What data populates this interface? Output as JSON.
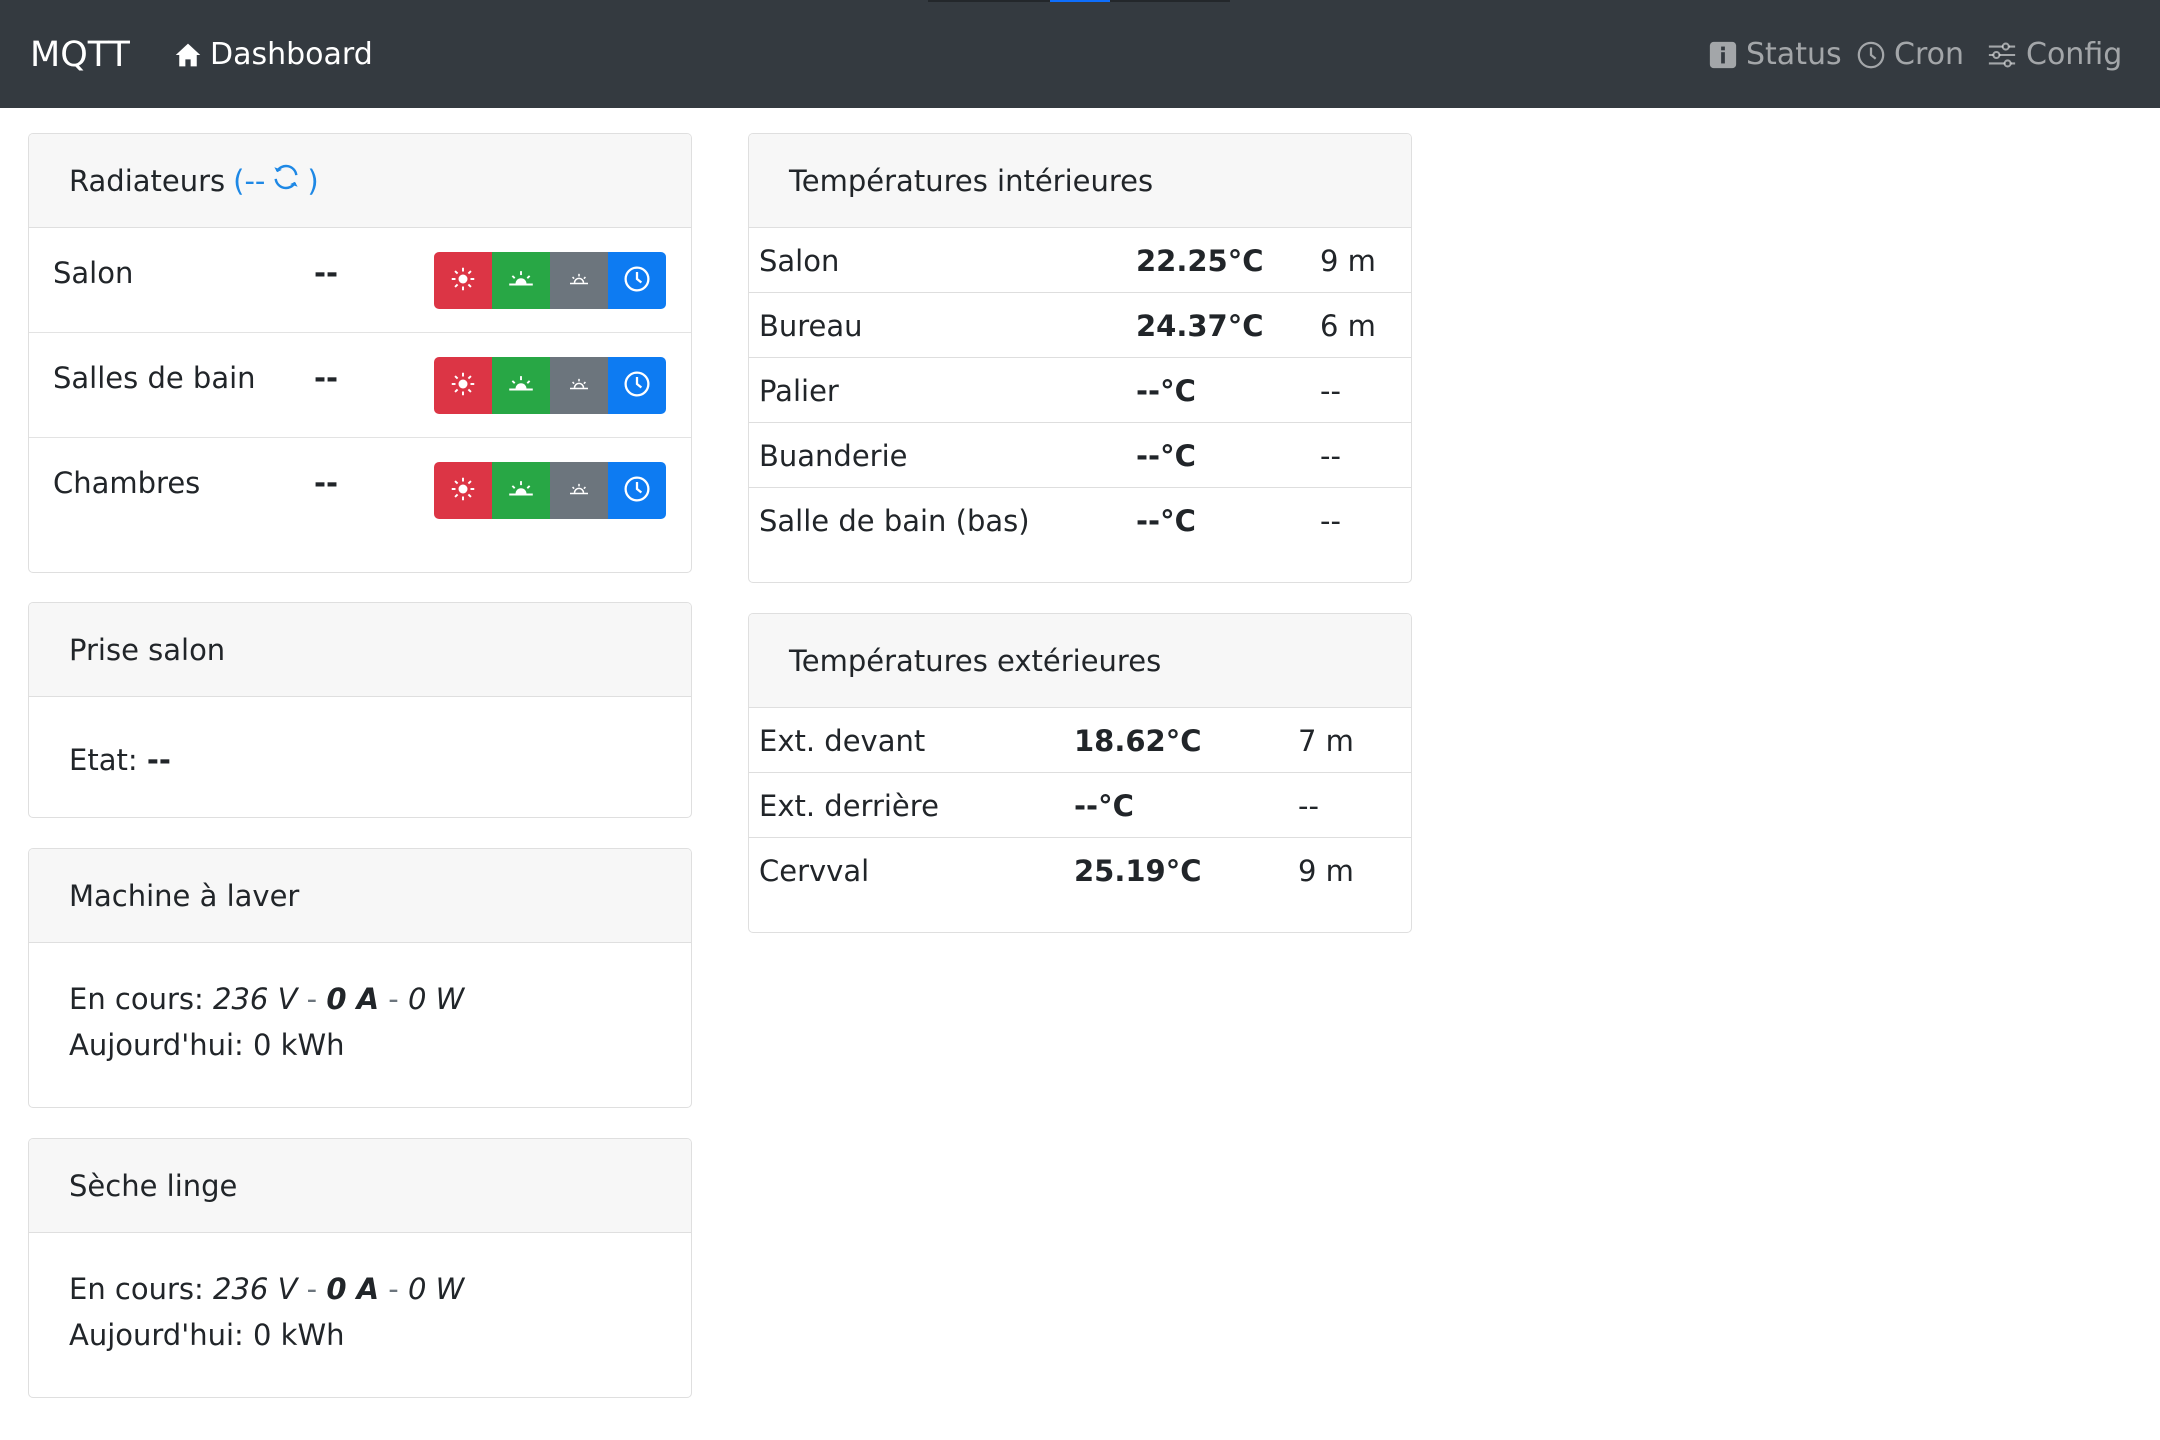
{
  "navbar": {
    "brand": "MQTT",
    "dashboard": "Dashboard",
    "status": "Status",
    "cron": "Cron",
    "config": "Config"
  },
  "radiateurs": {
    "title": "Radiateurs",
    "status_open": "(--",
    "status_close": ")",
    "rows": [
      {
        "name": "Salon",
        "value": "--"
      },
      {
        "name": "Salles de bain",
        "value": "--"
      },
      {
        "name": "Chambres",
        "value": "--"
      }
    ]
  },
  "prise_salon": {
    "title": "Prise salon",
    "etat_label": "Etat:",
    "etat_value": "--"
  },
  "machine": {
    "title": "Machine à laver",
    "en_cours_label": "En cours:",
    "voltage": "236 V",
    "current": "0 A",
    "power": "0 W",
    "sep": "-",
    "today_label": "Aujourd'hui:",
    "today_value": "0 kWh"
  },
  "seche": {
    "title": "Sèche linge",
    "en_cours_label": "En cours:",
    "voltage": "236 V",
    "current": "0 A",
    "power": "0 W",
    "sep": "-",
    "today_label": "Aujourd'hui:",
    "today_value": "0 kWh"
  },
  "temp_int": {
    "title": "Températures intérieures",
    "rows": [
      {
        "name": "Salon",
        "temp": "22.25°C",
        "age": "9 m"
      },
      {
        "name": "Bureau",
        "temp": "24.37°C",
        "age": "6 m"
      },
      {
        "name": "Palier",
        "temp": "--°C",
        "age": "--"
      },
      {
        "name": "Buanderie",
        "temp": "--°C",
        "age": "--"
      },
      {
        "name": "Salle de bain (bas)",
        "temp": "--°C",
        "age": "--"
      }
    ]
  },
  "temp_ext": {
    "title": "Températures extérieures",
    "rows": [
      {
        "name": "Ext. devant",
        "temp": "18.62°C",
        "age": "7 m"
      },
      {
        "name": "Ext. derrière",
        "temp": "--°C",
        "age": "--"
      },
      {
        "name": "Cervval",
        "temp": "25.19°C",
        "age": "9 m"
      }
    ]
  },
  "colors": {
    "navbar": "#343a40",
    "danger": "#dc3545",
    "success": "#28a745",
    "secondary": "#6c757d",
    "primary": "#0d7bf2",
    "link": "#1e88e5"
  },
  "icons": {
    "dashboard": "house-icon",
    "status": "info-icon",
    "cron": "clock-icon",
    "config": "sliders-icon",
    "refresh": "refresh-icon",
    "mode_comfort": "sun-icon",
    "mode_eco": "sunrise-icon",
    "mode_off": "sunset-icon",
    "mode_schedule": "clock-icon"
  }
}
